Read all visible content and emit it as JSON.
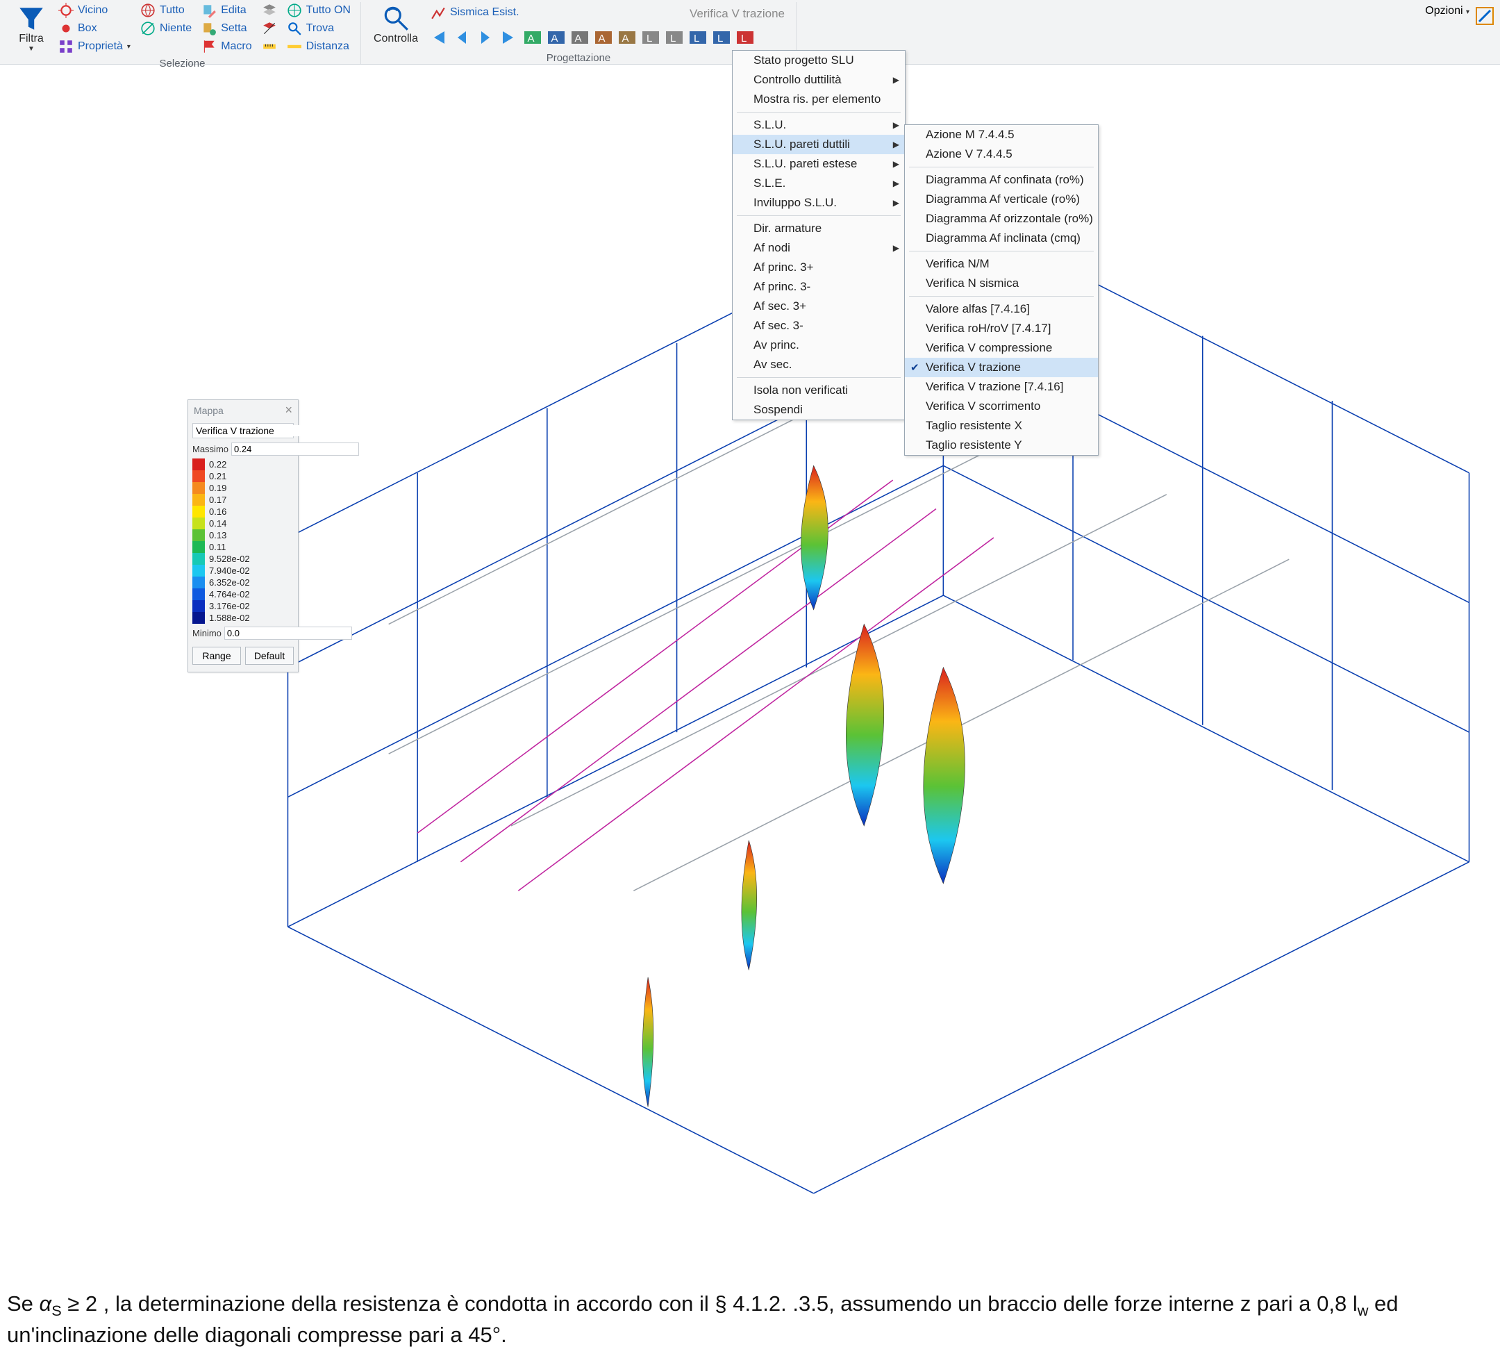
{
  "ribbon": {
    "filtra": "Filtra",
    "vicino": "Vicino",
    "box": "Box",
    "proprieta": "Proprietà",
    "tutto": "Tutto",
    "niente": "Niente",
    "edita": "Edita",
    "setta": "Setta",
    "macro": "Macro",
    "tuttoon": "Tutto ON",
    "trova": "Trova",
    "distanza": "Distanza",
    "selezione_label": "Selezione",
    "controlla": "Controlla",
    "sismica": "Sismica Esist.",
    "progettazione_label": "Progettazione",
    "dropdown_value": "Verifica V trazione",
    "opzioni": "Opzioni"
  },
  "menu1": {
    "items": [
      {
        "label": "Stato progetto SLU",
        "sub": false
      },
      {
        "label": "Controllo duttilità",
        "sub": true
      },
      {
        "label": "Mostra ris. per elemento",
        "sub": false
      },
      {
        "sep": true
      },
      {
        "label": "S.L.U.",
        "sub": true
      },
      {
        "label": "S.L.U. pareti duttili",
        "sub": true,
        "highlight": true
      },
      {
        "label": "S.L.U. pareti estese",
        "sub": true
      },
      {
        "label": "S.L.E.",
        "sub": true
      },
      {
        "label": "Inviluppo S.L.U.",
        "sub": true
      },
      {
        "sep": true
      },
      {
        "label": "Dir. armature",
        "sub": false
      },
      {
        "label": "Af nodi",
        "sub": true
      },
      {
        "label": "Af princ. 3+",
        "sub": false
      },
      {
        "label": "Af princ. 3-",
        "sub": false
      },
      {
        "label": "Af sec. 3+",
        "sub": false
      },
      {
        "label": "Af sec. 3-",
        "sub": false
      },
      {
        "label": "Av princ.",
        "sub": false
      },
      {
        "label": "Av sec.",
        "sub": false
      },
      {
        "sep": true
      },
      {
        "label": "Isola non verificati",
        "sub": false
      },
      {
        "label": "Sospendi",
        "sub": false
      }
    ]
  },
  "menu2": {
    "items": [
      {
        "label": "Azione M 7.4.4.5"
      },
      {
        "label": "Azione V 7.4.4.5"
      },
      {
        "sep": true
      },
      {
        "label": "Diagramma Af confinata (ro%)"
      },
      {
        "label": "Diagramma Af verticale (ro%)"
      },
      {
        "label": "Diagramma Af orizzontale (ro%)"
      },
      {
        "label": "Diagramma Af inclinata (cmq)"
      },
      {
        "sep": true
      },
      {
        "label": "Verifica N/M"
      },
      {
        "label": "Verifica N sismica"
      },
      {
        "sep": true
      },
      {
        "label": "Valore alfas [7.4.16]"
      },
      {
        "label": "Verifica roH/roV [7.4.17]"
      },
      {
        "label": "Verifica V compressione"
      },
      {
        "label": "Verifica V trazione",
        "checked": true,
        "highlight": true
      },
      {
        "label": "Verifica V trazione [7.4.16]"
      },
      {
        "label": "Verifica V scorrimento"
      },
      {
        "label": "Taglio resistente X"
      },
      {
        "label": "Taglio resistente Y"
      }
    ]
  },
  "legend": {
    "title": "Mappa",
    "field_value": "Verifica V trazione",
    "max_label": "Massimo",
    "max_value": "0.24",
    "min_label": "Minimo",
    "min_value": "0.0",
    "range_btn": "Range",
    "default_btn": "Default",
    "scale": [
      {
        "c": "#d9201e",
        "v": "0.22"
      },
      {
        "c": "#ef4922",
        "v": "0.21"
      },
      {
        "c": "#f58a1f",
        "v": "0.19"
      },
      {
        "c": "#fbb615",
        "v": "0.17"
      },
      {
        "c": "#ffe600",
        "v": "0.16"
      },
      {
        "c": "#c7e21b",
        "v": "0.14"
      },
      {
        "c": "#5bc236",
        "v": "0.13"
      },
      {
        "c": "#1db954",
        "v": "0.11"
      },
      {
        "c": "#17c9b5",
        "v": "9.528e-02"
      },
      {
        "c": "#1cc7f0",
        "v": "7.940e-02"
      },
      {
        "c": "#1a8ef0",
        "v": "6.352e-02"
      },
      {
        "c": "#0f5ae0",
        "v": "4.764e-02"
      },
      {
        "c": "#0a2ebf",
        "v": "3.176e-02"
      },
      {
        "c": "#05168f",
        "v": "1.588e-02"
      }
    ]
  },
  "paragraph": {
    "pre": "Se ",
    "alpha": "α",
    "sub": "S",
    "cond": " ≥ 2 , la determinazione della resistenza è condotta in accordo con il § 4.1.2. .3.5, assumendo un braccio delle forze interne z pari a 0,8 l",
    "sub2": "w",
    "post": " ed un'inclinazione delle diagonali compresse pari a 45°."
  }
}
